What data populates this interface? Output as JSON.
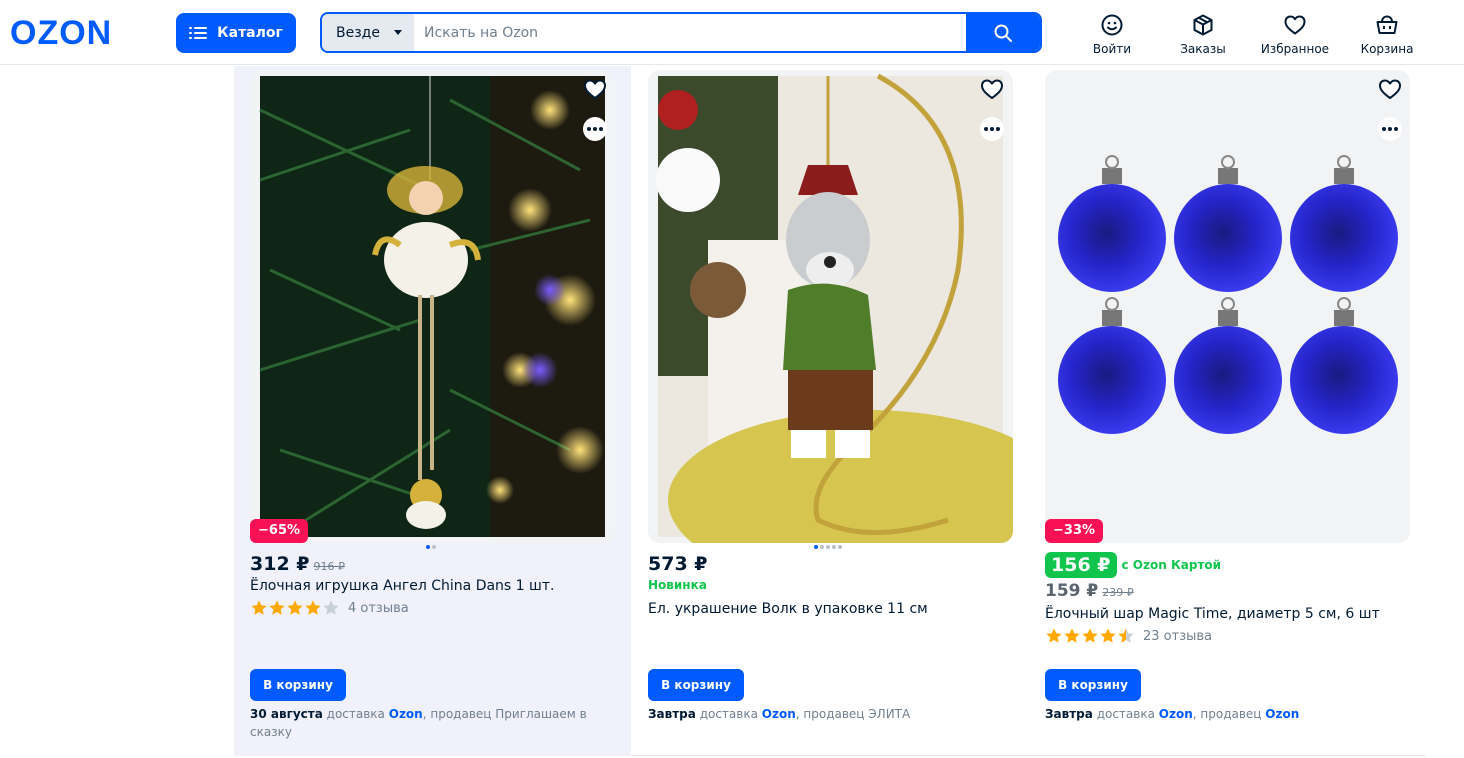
{
  "header": {
    "logo": "OZON",
    "catalog_label": "Каталог",
    "search_scope": "Везде",
    "search_placeholder": "Искать на Ozon",
    "nav": [
      {
        "label": "Войти",
        "icon": "face-icon"
      },
      {
        "label": "Заказы",
        "icon": "box-icon"
      },
      {
        "label": "Избранное",
        "icon": "heart-icon"
      },
      {
        "label": "Корзина",
        "icon": "basket-icon"
      }
    ]
  },
  "products": [
    {
      "discount": "−65%",
      "price": "312 ₽",
      "old_price": "916 ₽",
      "title": "Ёлочная игрушка Ангел China Dans 1 шт.",
      "rating": 4,
      "reviews": "4 отзыва",
      "cart_label": "В корзину",
      "delivery_date": "30 августа",
      "delivery_word": "доставка",
      "delivery_by": "Ozon",
      "seller_prefix": ", продавец Приглашаем в сказку",
      "image_dots": 2
    },
    {
      "price": "573 ₽",
      "badge_text": "Новинка",
      "title": "Ел. украшение Волк в упаковке 11 см",
      "cart_label": "В корзину",
      "delivery_date": "Завтра",
      "delivery_word": "доставка",
      "delivery_by": "Ozon",
      "seller_prefix": ", продавец ЭЛИТА",
      "image_dots": 5
    },
    {
      "discount": "−33%",
      "card_price": "156 ₽",
      "card_price_label": "с Ozon Картой",
      "price": "159 ₽",
      "old_price": "239 ₽",
      "title": "Ёлочный шар Magic Time, диаметр 5 см, 6 шт",
      "rating": 4.5,
      "reviews": "23 отзыва",
      "cart_label": "В корзину",
      "delivery_date": "Завтра",
      "delivery_word": "доставка",
      "delivery_by": "Ozon",
      "seller_prefix": ", продавец ",
      "seller_link": "Ozon"
    }
  ],
  "colors": {
    "brand": "#005bff",
    "discount": "#f91155",
    "green": "#10c44c",
    "star": "#ffa800"
  }
}
